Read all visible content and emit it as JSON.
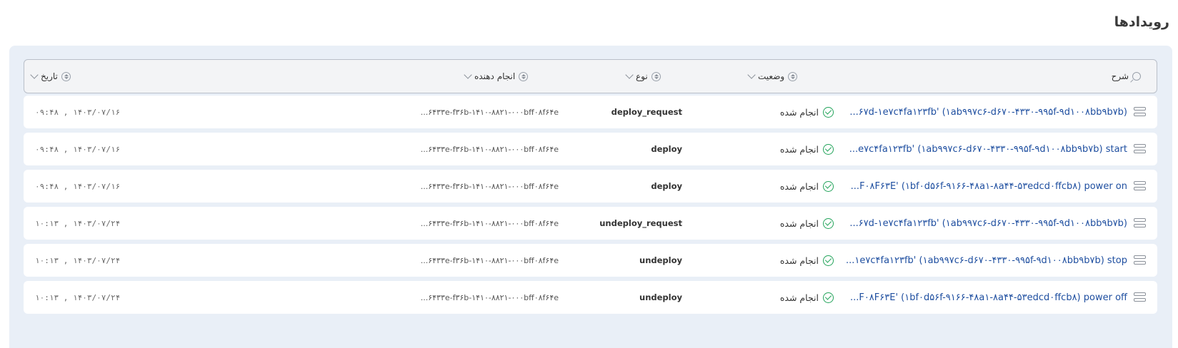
{
  "page_title": "رویدادها",
  "table": {
    "columns": {
      "description": "شرح",
      "status": "وضعیت",
      "type": "نوع",
      "actor": "انجام دهنده",
      "date": "تاریخ"
    },
    "rows": [
      {
        "description": "...۶۷d-۱e۷c۴fa۱۲۳fb' (۱ab۹۹۷c۶-d۶۷۰-۴۳۳۰-۹۹۵f-۹d۱۰۰۸bb۹b۷b)",
        "status": "انجام شده",
        "type": "deploy_request",
        "actor": "...۶۴۳۳e-f۳۶b-۱۴۱۰-۸۸۲۱-۰۰۰bff۰۸f۶۴e",
        "date": "۱۴۰۳/۰۷/۱۶ , ۰۹:۴۸"
      },
      {
        "description": "...e۷c۴fa۱۲۳fb' (۱ab۹۹۷c۶-d۶۷۰-۴۳۳۰-۹۹۵f-۹d۱۰۰۸bb۹b۷b) start",
        "status": "انجام شده",
        "type": "deploy",
        "actor": "...۶۴۳۳e-f۳۶b-۱۴۱۰-۸۸۲۱-۰۰۰bff۰۸f۶۴e",
        "date": "۱۴۰۳/۰۷/۱۶ , ۰۹:۴۸"
      },
      {
        "description": "...F۰۸F۶۳E' (۱bf۰d۵۶f-۹۱۶۶-۴۸a۱-۸a۴۴-۵۳edcd۰ffcb۸) power on",
        "status": "انجام شده",
        "type": "deploy",
        "actor": "...۶۴۳۳e-f۳۶b-۱۴۱۰-۸۸۲۱-۰۰۰bff۰۸f۶۴e",
        "date": "۱۴۰۳/۰۷/۱۶ , ۰۹:۴۸"
      },
      {
        "description": "...۶۷d-۱e۷c۴fa۱۲۳fb' (۱ab۹۹۷c۶-d۶۷۰-۴۳۳۰-۹۹۵f-۹d۱۰۰۸bb۹b۷b)",
        "status": "انجام شده",
        "type": "undeploy_request",
        "actor": "...۶۴۳۳e-f۳۶b-۱۴۱۰-۸۸۲۱-۰۰۰bff۰۸f۶۴e",
        "date": "۱۴۰۳/۰۷/۲۴ , ۱۰:۱۳"
      },
      {
        "description": "...۱e۷c۴fa۱۲۳fb' (۱ab۹۹۷c۶-d۶۷۰-۴۳۳۰-۹۹۵f-۹d۱۰۰۸bb۹b۷b) stop",
        "status": "انجام شده",
        "type": "undeploy",
        "actor": "...۶۴۳۳e-f۳۶b-۱۴۱۰-۸۸۲۱-۰۰۰bff۰۸f۶۴e",
        "date": "۱۴۰۳/۰۷/۲۴ , ۱۰:۱۳"
      },
      {
        "description": "...F۰۸F۶۳E' (۱bf۰d۵۶f-۹۱۶۶-۴۸a۱-۸a۴۴-۵۳edcd۰ffcb۸) power off",
        "status": "انجام شده",
        "type": "undeploy",
        "actor": "...۶۴۳۳e-f۳۶b-۱۴۱۰-۸۸۲۱-۰۰۰bff۰۸f۶۴e",
        "date": "۱۴۰۳/۰۷/۲۴ , ۱۰:۱۳"
      }
    ]
  },
  "colors": {
    "panel_background": "#e9eff7",
    "description_link": "#1f4fa0",
    "status_ok": "#22a35a"
  },
  "icons": {
    "search": "search-icon",
    "sort": "sort-icon",
    "dropdown": "chevron-down-icon",
    "status_done": "check-circle-icon",
    "row_handle": "drag-handle-icon"
  }
}
